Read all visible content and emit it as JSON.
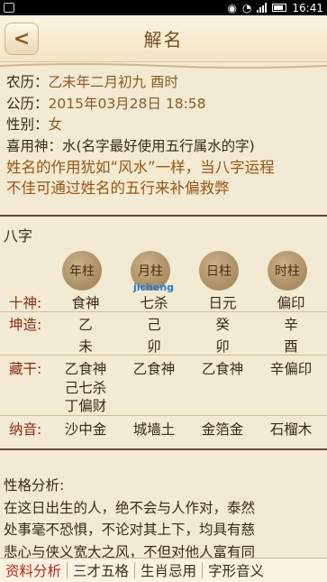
{
  "status": {
    "time": "16:41"
  },
  "header": {
    "title": "解名",
    "back": "<"
  },
  "info": {
    "lunar_label": "农历：",
    "lunar_value": "乙未年二月初九 酉时",
    "solar_label": "公历：",
    "solar_value": "2015年03月28日 18:58",
    "gender_label": "性别：",
    "gender_value": "女",
    "xiyong_label": "喜用神：",
    "xiyong_value": "水(名字最好使用五行属水的字)",
    "desc1": "姓名的作用犹如“风水”一样，当八字运程",
    "desc2": "不佳可通过姓名的五行来补偏救弊"
  },
  "bazi": {
    "title": "八字",
    "pillars": [
      "年柱",
      "月柱",
      "日柱",
      "时柱"
    ],
    "shishen_label": "十神:",
    "shishen": [
      "食神",
      "七杀",
      "日元",
      "偏印"
    ],
    "kunzao_label": "坤造:",
    "gan": [
      "乙",
      "己",
      "癸",
      "辛"
    ],
    "zhi": [
      "未",
      "卯",
      "卯",
      "酉"
    ],
    "canggan_label": "藏干:",
    "canggan": [
      [
        "乙食神",
        "己七杀",
        "丁偏财"
      ],
      [
        "乙食神"
      ],
      [
        "乙食神"
      ],
      [
        "辛偏印"
      ]
    ],
    "nayin_label": "纳音:",
    "nayin": [
      "沙中金",
      "城墙土",
      "金箔金",
      "石榴木"
    ]
  },
  "watermark": "jicheng",
  "persona": {
    "title": "性格分析:",
    "lines": [
      "在这日出生的人，绝不会与人作对，泰然",
      "处事毫不恐惧，不论对其上下，均具有慈",
      "悲心与侠义宽大之风，不但对他人富有同"
    ]
  },
  "tabs": [
    "资料分析",
    "三才五格",
    "生肖忌用",
    "字形音义"
  ]
}
